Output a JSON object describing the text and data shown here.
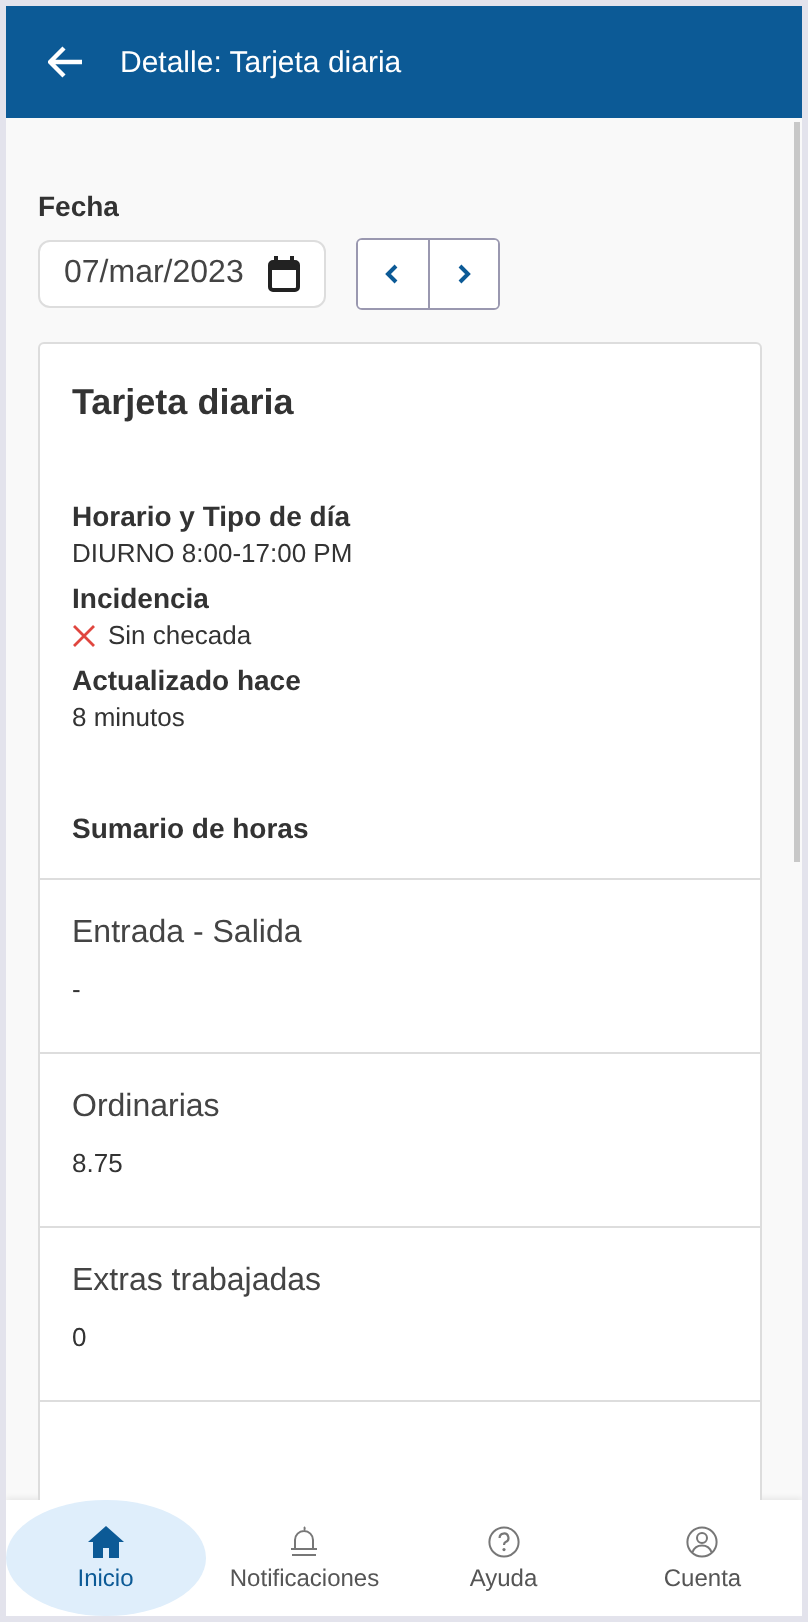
{
  "header": {
    "title": "Detalle: Tarjeta diaria"
  },
  "date": {
    "label": "Fecha",
    "value": "07/mar/2023"
  },
  "card": {
    "title": "Tarjeta diaria",
    "details": [
      {
        "label": "Horario y Tipo de día",
        "value": "DIURNO 8:00-17:00 PM",
        "kind": "text"
      },
      {
        "label": "Incidencia",
        "value": "Sin checada",
        "kind": "error"
      },
      {
        "label": "Actualizado hace",
        "value": "8 minutos",
        "kind": "text"
      }
    ],
    "summary_title": "Sumario de horas",
    "summary": [
      {
        "label": "Entrada - Salida",
        "value": "-"
      },
      {
        "label": "Ordinarias",
        "value": "8.75"
      },
      {
        "label": "Extras trabajadas",
        "value": "0"
      }
    ]
  },
  "nav": [
    {
      "label": "Inicio",
      "kind": "home",
      "selected": true
    },
    {
      "label": "Notificaciones",
      "kind": "alerts",
      "selected": false
    },
    {
      "label": "Ayuda",
      "kind": "help",
      "selected": false
    },
    {
      "label": "Cuenta",
      "kind": "account",
      "selected": false
    }
  ]
}
